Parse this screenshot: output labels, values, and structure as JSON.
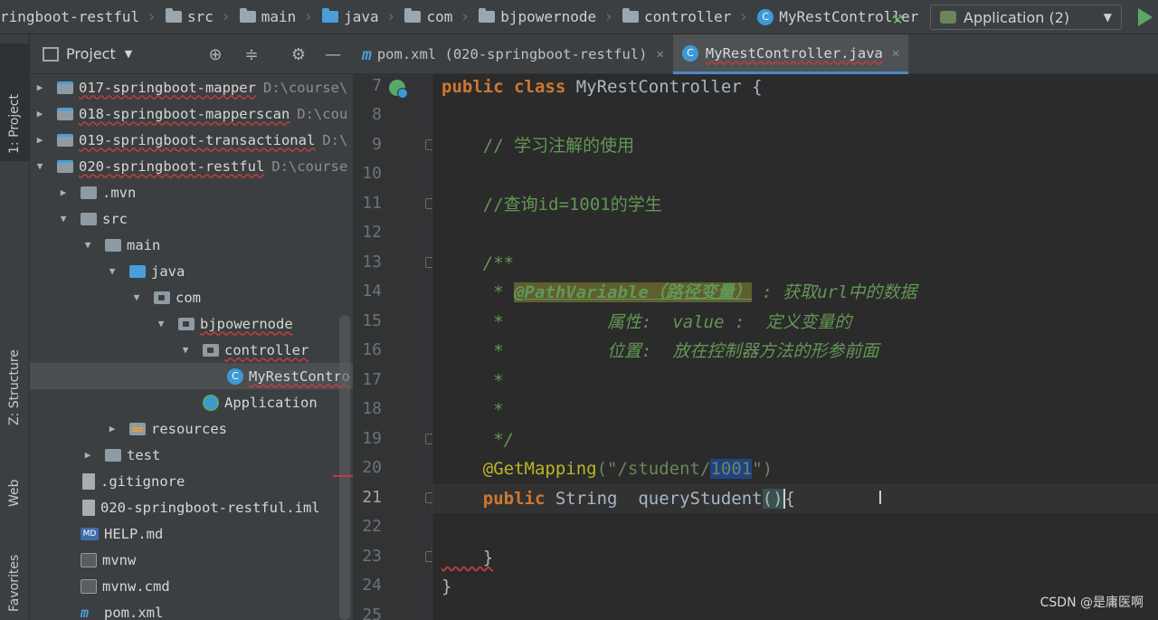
{
  "breadcrumbs": [
    "ringboot-restful",
    "src",
    "main",
    "java",
    "com",
    "bjpowernode",
    "controller",
    "MyRestController"
  ],
  "run_config": {
    "label": "Application (2)"
  },
  "left_strip": {
    "project": "1: Project",
    "structure": "Z: Structure",
    "web": "Web",
    "favorites": "Favorites"
  },
  "project_panel": {
    "title": "Project",
    "rows": [
      {
        "label": "017-springboot-mapper",
        "path": "D:\\course\\"
      },
      {
        "label": "018-springboot-mapperscan",
        "path": "D:\\cou"
      },
      {
        "label": "019-springboot-transactional",
        "path": "D:\\"
      },
      {
        "label": "020-springboot-restful",
        "path": "D:\\course"
      },
      {
        "label": ".mvn"
      },
      {
        "label": "src"
      },
      {
        "label": "main"
      },
      {
        "label": "java"
      },
      {
        "label": "com"
      },
      {
        "label": "bjpowernode"
      },
      {
        "label": "controller"
      },
      {
        "label": "MyRestContro"
      },
      {
        "label": "Application"
      },
      {
        "label": "resources"
      },
      {
        "label": "test"
      },
      {
        "label": ".gitignore"
      },
      {
        "label": "020-springboot-restful.iml"
      },
      {
        "label": "HELP.md"
      },
      {
        "label": "mvnw"
      },
      {
        "label": "mvnw.cmd"
      },
      {
        "label": "pom.xml"
      }
    ]
  },
  "editor_tabs": [
    {
      "label": "pom.xml (020-springboot-restful)"
    },
    {
      "label": "MyRestController.java"
    }
  ],
  "code": {
    "line_numbers": [
      "7",
      "8",
      "9",
      "10",
      "11",
      "12",
      "13",
      "14",
      "15",
      "16",
      "17",
      "18",
      "19",
      "20",
      "21",
      "22",
      "23",
      "24",
      "25"
    ],
    "l7_kw": "public class",
    "l7_rest": " MyRestController {",
    "l9": "    // 学习注解的使用",
    "l11": "    //查询id=1001的学生",
    "l13": "    /**",
    "l14_pre": "     * ",
    "l14_tag": "@PathVariable（路径变量）",
    "l14_post": " : 获取url中的数据",
    "l15": "     *          属性:  value :  定义变量的",
    "l16": "     *          位置:  放在控制器方法的形参前面",
    "l17": "     *",
    "l18": "     *",
    "l19": "     */",
    "l20_ann": "    @GetMapping",
    "l20_a": "(\"/student/",
    "l20_sel": "1001",
    "l20_b": "\")",
    "l21_kw": "    public",
    "l21_type": " String ",
    "l21_name": " queryStudent",
    "l21_paren": "()",
    "l21_brace": "{",
    "l23": "    }",
    "l24": "}"
  },
  "watermark": "CSDN @是庸医啊"
}
